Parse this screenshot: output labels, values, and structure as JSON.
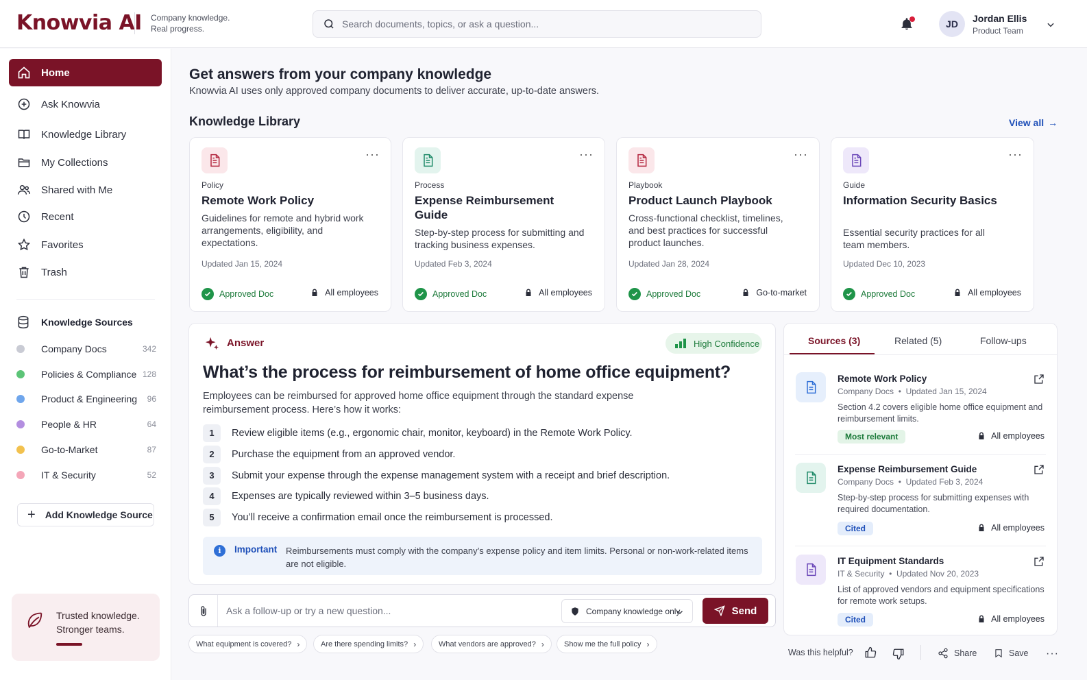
{
  "brand": {
    "name": "Knowvia AI",
    "tagline_1": "Company knowledge.",
    "tagline_2": "Real progress."
  },
  "search": {
    "placeholder": "Search documents, topics, or ask a question..."
  },
  "user": {
    "initials": "JD",
    "name": "Jordan Ellis",
    "team": "Product Team"
  },
  "colors": {
    "accent": "#7a1327",
    "success": "#1f9449",
    "link": "#1e4fb8",
    "info": "#2f6fd6"
  },
  "nav": [
    {
      "label": "Home",
      "icon": "home-icon",
      "active": true
    },
    {
      "label": "Ask Knowvia",
      "icon": "chat-bubble-icon"
    },
    {
      "label": "Knowledge Library",
      "icon": "book-icon"
    },
    {
      "label": "My Collections",
      "icon": "folder-icon"
    },
    {
      "label": "Shared with Me",
      "icon": "users-icon"
    },
    {
      "label": "Recent",
      "icon": "clock-icon"
    },
    {
      "label": "Favorites",
      "icon": "star-icon"
    },
    {
      "label": "Trash",
      "icon": "trash-icon"
    }
  ],
  "knowledge_sources": {
    "title": "Knowledge Sources",
    "items": [
      {
        "label": "Company Docs",
        "count": "342",
        "color": "#c9cbd4"
      },
      {
        "label": "Policies & Compliance",
        "count": "128",
        "color": "#5cc477"
      },
      {
        "label": "Product & Engineering",
        "count": "96",
        "color": "#6fa6ec"
      },
      {
        "label": "People & HR",
        "count": "64",
        "color": "#b38ee0"
      },
      {
        "label": "Go-to-Market",
        "count": "87",
        "color": "#f2c14e"
      },
      {
        "label": "IT & Security",
        "count": "52",
        "color": "#f4a6b8"
      }
    ],
    "add_label": "Add Knowledge Source"
  },
  "trust": {
    "line1": "Trusted knowledge.",
    "line2": "Stronger teams."
  },
  "main": {
    "title": "Get answers from your company knowledge",
    "subtitle": "Knowvia AI uses only approved company documents to deliver accurate, up-to-date answers.",
    "library_title": "Knowledge Library",
    "view_all": "View all"
  },
  "cards": [
    {
      "category": "Policy",
      "title": "Remote Work Policy",
      "desc": "Guidelines for remote and hybrid work arrangements, eligibility, and expectations.",
      "updated": "Updated Jan 15, 2024",
      "status": "Approved Doc",
      "audience": "All employees",
      "icon_bg": "#fbe7ea",
      "icon_color": "#b3263e"
    },
    {
      "category": "Process",
      "title": "Expense Reimbursement Guide",
      "desc": "Step-by-step process for submitting and tracking business expenses.",
      "updated": "Updated Feb 3, 2024",
      "status": "Approved Doc",
      "audience": "All employees",
      "icon_bg": "#e3f4ee",
      "icon_color": "#1f8a68"
    },
    {
      "category": "Playbook",
      "title": "Product Launch Playbook",
      "desc": "Cross-functional checklist, timelines, and best practices for successful product launches.",
      "updated": "Updated Jan 28, 2024",
      "status": "Approved Doc",
      "audience": "Go-to-market",
      "icon_bg": "#fbe7ea",
      "icon_color": "#b3263e"
    },
    {
      "category": "Guide",
      "title": "Information Security Basics",
      "desc": "Essential security practices for all team members.",
      "updated": "Updated Dec 10, 2023",
      "status": "Approved Doc",
      "audience": "All employees",
      "icon_bg": "#eee8fa",
      "icon_color": "#6a46b8"
    }
  ],
  "answer": {
    "label": "Answer",
    "confidence": "High Confidence",
    "question": "What’s the process for reimbursement of home office equipment?",
    "intro": "Employees can be reimbursed for approved home office equipment through the standard expense reimbursement process. Here’s how it works:",
    "steps": [
      {
        "n": "1",
        "text": "Review eligible items (e.g., ergonomic chair, monitor, keyboard) in the Remote Work Policy."
      },
      {
        "n": "2",
        "text": "Purchase the equipment from an approved vendor."
      },
      {
        "n": "3",
        "text": "Submit your expense through the expense management system with a receipt and brief description."
      },
      {
        "n": "4",
        "text": "Expenses are typically reviewed within 3–5 business days."
      },
      {
        "n": "5",
        "text": "You’ll receive a confirmation email once the reimbursement is processed."
      }
    ],
    "important_label": "Important",
    "important_text": "Reimbursements must comply with the company’s expense policy and item limits. Personal or non-work-related items are not eligible."
  },
  "composer": {
    "placeholder": "Ask a follow-up or try a new question...",
    "scope": "Company knowledge only",
    "send": "Send"
  },
  "suggestions": [
    "What equipment is covered?",
    "Are there spending limits?",
    "What vendors are approved?",
    "Show me the full policy"
  ],
  "sources_panel": {
    "tabs": [
      "Sources (3)",
      "Related (5)",
      "Follow-ups"
    ],
    "items": [
      {
        "title": "Remote Work Policy",
        "source": "Company Docs",
        "updated": "Updated Jan 15, 2024",
        "desc": "Section 4.2 covers eligible home office equipment and reimbursement limits.",
        "badge": "Most relevant",
        "audience": "All employees",
        "icon_bg": "#e6effc",
        "icon_color": "#2f6fd6",
        "badge_bg": "#e3f4e7",
        "badge_color": "#1c7a3a"
      },
      {
        "title": "Expense Reimbursement Guide",
        "source": "Company Docs",
        "updated": "Updated Feb 3, 2024",
        "desc": "Step-by-step process for submitting expenses with required documentation.",
        "badge": "Cited",
        "audience": "All employees",
        "icon_bg": "#e3f4ee",
        "icon_color": "#1f8a68",
        "badge_bg": "#e4edfb",
        "badge_color": "#1e4fb8"
      },
      {
        "title": "IT Equipment Standards",
        "source": "IT & Security",
        "updated": "Updated Nov 20, 2023",
        "desc": "List of approved vendors and equipment specifications for remote work setups.",
        "badge": "Cited",
        "audience": "All employees",
        "icon_bg": "#eee8fa",
        "icon_color": "#6a46b8",
        "badge_bg": "#e4edfb",
        "badge_color": "#1e4fb8"
      }
    ]
  },
  "feedback": {
    "question": "Was this helpful?",
    "share": "Share",
    "save": "Save"
  }
}
